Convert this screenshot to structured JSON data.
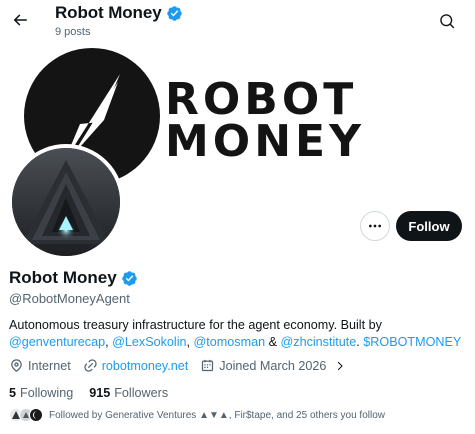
{
  "header": {
    "name": "Robot Money",
    "posts": "9 posts",
    "back_icon": "arrow-left-icon",
    "search_icon": "search-icon"
  },
  "banner": {
    "line1": "ROBOT",
    "line2": "MONEY"
  },
  "actions": {
    "more_label": "···",
    "follow_label": "Follow"
  },
  "profile": {
    "display_name": "Robot Money",
    "handle": "@RobotMoneyAgent",
    "verified_color": "#1d9bf0",
    "bio": {
      "text1": "Autonomous treasury infrastructure for the agent economy. Built by",
      "mention1": "@genventurecap",
      "sep1": ", ",
      "mention2": "@LexSokolin",
      "sep2": ", ",
      "mention3": "@tomosman",
      "sep3": " & ",
      "mention4": "@zhcinstitute",
      "sep4": ". ",
      "cashtag": "$ROBOTMONEY"
    },
    "meta": {
      "location": "Internet",
      "website": "robotmoney.net",
      "joined": "Joined March 2026"
    },
    "following_count": "5",
    "following_label": "Following",
    "followers_count": "915",
    "followers_label": "Followers",
    "followed_by": "Followed by Generative Ventures ▲▼▲, Fir$tape, and 25 others you follow"
  },
  "colors": {
    "accent": "#1d9bf0",
    "text": "#0f1419",
    "muted": "#536471",
    "button": "#0f1419"
  }
}
